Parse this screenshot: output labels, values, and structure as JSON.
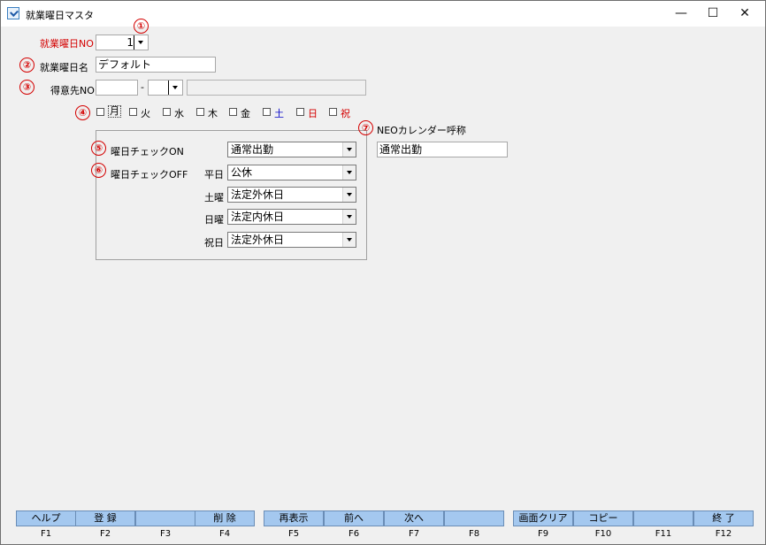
{
  "window": {
    "title": "就業曜日マスタ",
    "controls": {
      "minimize": "—",
      "maximize": "☐",
      "close": "✕"
    }
  },
  "form": {
    "workday_no": {
      "label": "就業曜日NO",
      "value": "1"
    },
    "workday_name": {
      "label": "就業曜日名",
      "value": "デフォルト"
    },
    "customer_no": {
      "label": "得意先NO",
      "value1": "",
      "separator": "-",
      "value2": "",
      "name": ""
    },
    "weekdays": [
      {
        "label": "月",
        "checked": false,
        "color": "#000000"
      },
      {
        "label": "火",
        "checked": false,
        "color": "#000000"
      },
      {
        "label": "水",
        "checked": false,
        "color": "#000000"
      },
      {
        "label": "木",
        "checked": false,
        "color": "#000000"
      },
      {
        "label": "金",
        "checked": false,
        "color": "#000000"
      },
      {
        "label": "土",
        "checked": false,
        "color": "#0000c8"
      },
      {
        "label": "日",
        "checked": false,
        "color": "#d40000"
      },
      {
        "label": "祝",
        "checked": false,
        "color": "#d40000"
      }
    ],
    "check_on": {
      "label": "曜日チェックON",
      "value": "通常出勤"
    },
    "check_off": {
      "label": "曜日チェックOFF",
      "weekday": {
        "label": "平日",
        "value": "公休"
      },
      "saturday": {
        "label": "土曜",
        "value": "法定外休日"
      },
      "sunday": {
        "label": "日曜",
        "value": "法定内休日"
      },
      "holiday": {
        "label": "祝日",
        "value": "法定外休日"
      }
    },
    "neo_calendar": {
      "label": "NEOカレンダー呼称",
      "value": "通常出勤"
    }
  },
  "annotations": [
    "①",
    "②",
    "③",
    "④",
    "⑤",
    "⑥",
    "⑦"
  ],
  "function_keys": [
    {
      "label": "ヘルプ",
      "key": "F1"
    },
    {
      "label": "登 録",
      "key": "F2"
    },
    {
      "label": "",
      "key": "F3"
    },
    {
      "label": "削 除",
      "key": "F4"
    },
    {
      "label": "再表示",
      "key": "F5"
    },
    {
      "label": "前へ",
      "key": "F6"
    },
    {
      "label": "次へ",
      "key": "F7"
    },
    {
      "label": "",
      "key": "F8"
    },
    {
      "label": "画面クリア",
      "key": "F9"
    },
    {
      "label": "コピー",
      "key": "F10"
    },
    {
      "label": "",
      "key": "F11"
    },
    {
      "label": "終 了",
      "key": "F12"
    }
  ],
  "colors": {
    "accent_red": "#d40000",
    "fkey_bg": "#a4c8ef",
    "saturday_blue": "#0000c8"
  }
}
